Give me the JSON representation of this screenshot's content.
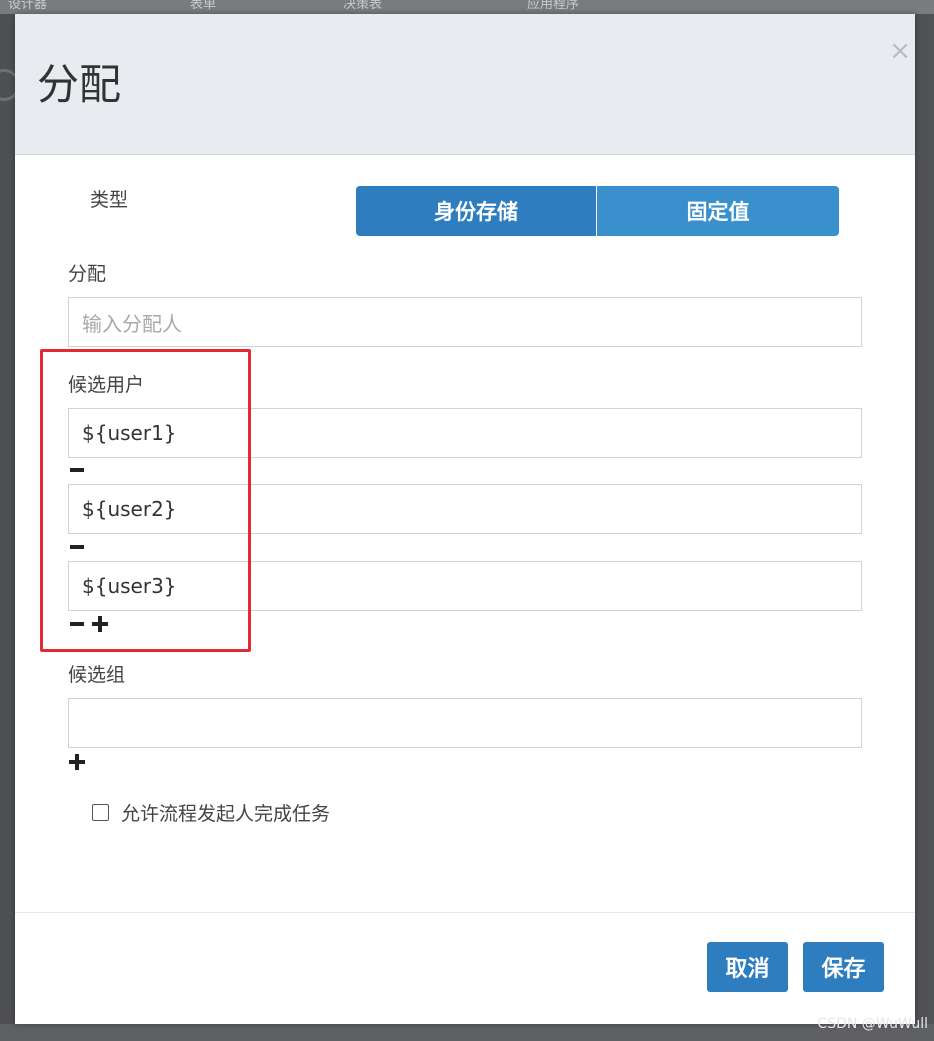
{
  "background": {
    "top_texts": [
      "设计器",
      "表单",
      "决策表",
      "应用程序"
    ]
  },
  "modal": {
    "title": "分配",
    "close_symbol": "×",
    "type": {
      "label": "类型",
      "options": [
        "身份存储",
        "固定值"
      ],
      "selected": "身份存储"
    },
    "assignee": {
      "label": "分配",
      "placeholder": "输入分配人",
      "value": ""
    },
    "candidate_users": {
      "label": "候选用户",
      "values": [
        "${user1}",
        "${user2}",
        "${user3}"
      ]
    },
    "candidate_groups": {
      "label": "候选组",
      "values": [
        ""
      ]
    },
    "allow_initiator": {
      "label": "允许流程发起人完成任务",
      "checked": false
    },
    "buttons": {
      "cancel": "取消",
      "save": "保存"
    }
  },
  "colors": {
    "primary": "#2e7ebf",
    "highlight": "#e02b35"
  },
  "icons": [
    "close-icon",
    "minus-icon",
    "plus-icon",
    "checkbox-icon"
  ],
  "watermark": "CSDN @WuWull"
}
